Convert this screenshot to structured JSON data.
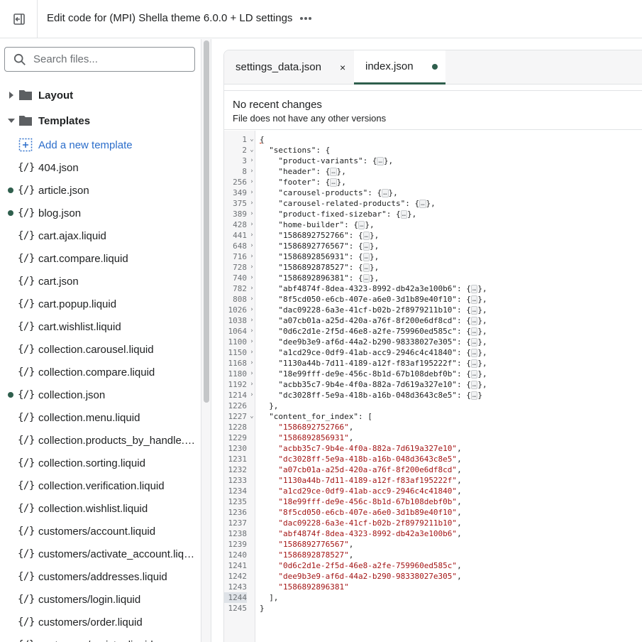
{
  "topbar": {
    "title": "Edit code for (MPI) Shella theme 6.0.0 + LD settings",
    "exit_icon": "exit-icon",
    "more_icon": "more-horizontal-icon"
  },
  "search": {
    "placeholder": "Search files..."
  },
  "tree": {
    "layout_label": "Layout",
    "templates_label": "Templates",
    "add_template_label": "Add a new template",
    "file_icon_glyph": "{/}",
    "files": [
      {
        "name": "404.json",
        "modified": false
      },
      {
        "name": "article.json",
        "modified": true
      },
      {
        "name": "blog.json",
        "modified": true
      },
      {
        "name": "cart.ajax.liquid",
        "modified": false
      },
      {
        "name": "cart.compare.liquid",
        "modified": false
      },
      {
        "name": "cart.json",
        "modified": false
      },
      {
        "name": "cart.popup.liquid",
        "modified": false
      },
      {
        "name": "cart.wishlist.liquid",
        "modified": false
      },
      {
        "name": "collection.carousel.liquid",
        "modified": false
      },
      {
        "name": "collection.compare.liquid",
        "modified": false
      },
      {
        "name": "collection.json",
        "modified": true
      },
      {
        "name": "collection.menu.liquid",
        "modified": false
      },
      {
        "name": "collection.products_by_handle.liquid",
        "modified": false
      },
      {
        "name": "collection.sorting.liquid",
        "modified": false
      },
      {
        "name": "collection.verification.liquid",
        "modified": false
      },
      {
        "name": "collection.wishlist.liquid",
        "modified": false
      },
      {
        "name": "customers/account.liquid",
        "modified": false
      },
      {
        "name": "customers/activate_account.liquid",
        "modified": false
      },
      {
        "name": "customers/addresses.liquid",
        "modified": false
      },
      {
        "name": "customers/login.liquid",
        "modified": false
      },
      {
        "name": "customers/order.liquid",
        "modified": false
      },
      {
        "name": "customers/register.liquid",
        "modified": false
      }
    ]
  },
  "tabs": [
    {
      "label": "settings_data.json",
      "close": "×"
    },
    {
      "label": "index.json"
    }
  ],
  "notice": {
    "title": "No recent changes",
    "subtitle": "File does not have any other versions"
  },
  "colors": {
    "accent": "#2f5f4d",
    "link": "#2c6ecb",
    "string": "#a31515"
  },
  "code": {
    "ellipsis": "…",
    "active_line": "1244",
    "lines": [
      {
        "n": "1",
        "f": "⌄",
        "indent": 0,
        "text": "{",
        "kind": "plain"
      },
      {
        "n": "2",
        "f": "⌄",
        "indent": 2,
        "text": "\"sections\": {",
        "kind": "plain"
      },
      {
        "n": "3",
        "f": "›",
        "indent": 4,
        "key": "\"product-variants\": ",
        "tail": "},",
        "kind": "fold"
      },
      {
        "n": "8",
        "f": "›",
        "indent": 4,
        "key": "\"header\": ",
        "tail": "},",
        "kind": "fold"
      },
      {
        "n": "256",
        "f": "›",
        "indent": 4,
        "key": "\"footer\": ",
        "tail": "},",
        "kind": "fold"
      },
      {
        "n": "349",
        "f": "›",
        "indent": 4,
        "key": "\"carousel-products\": ",
        "tail": "},",
        "kind": "fold"
      },
      {
        "n": "375",
        "f": "›",
        "indent": 4,
        "key": "\"carousel-related-products\": ",
        "tail": "},",
        "kind": "fold"
      },
      {
        "n": "389",
        "f": "›",
        "indent": 4,
        "key": "\"product-fixed-sizebar\": ",
        "tail": "},",
        "kind": "fold"
      },
      {
        "n": "428",
        "f": "›",
        "indent": 4,
        "key": "\"home-builder\": ",
        "tail": "},",
        "kind": "fold"
      },
      {
        "n": "441",
        "f": "›",
        "indent": 4,
        "key": "\"1586892752766\": ",
        "tail": "},",
        "kind": "fold"
      },
      {
        "n": "648",
        "f": "›",
        "indent": 4,
        "key": "\"1586892776567\": ",
        "tail": "},",
        "kind": "fold"
      },
      {
        "n": "716",
        "f": "›",
        "indent": 4,
        "key": "\"1586892856931\": ",
        "tail": "},",
        "kind": "fold"
      },
      {
        "n": "728",
        "f": "›",
        "indent": 4,
        "key": "\"1586892878527\": ",
        "tail": "},",
        "kind": "fold"
      },
      {
        "n": "740",
        "f": "›",
        "indent": 4,
        "key": "\"1586892896381\": ",
        "tail": "},",
        "kind": "fold"
      },
      {
        "n": "782",
        "f": "›",
        "indent": 4,
        "key": "\"abf4874f-8dea-4323-8992-db42a3e100b6\": ",
        "tail": "},",
        "kind": "fold"
      },
      {
        "n": "808",
        "f": "›",
        "indent": 4,
        "key": "\"8f5cd050-e6cb-407e-a6e0-3d1b89e40f10\": ",
        "tail": "},",
        "kind": "fold"
      },
      {
        "n": "1026",
        "f": "›",
        "indent": 4,
        "key": "\"dac09228-6a3e-41cf-b02b-2f8979211b10\": ",
        "tail": "},",
        "kind": "fold"
      },
      {
        "n": "1038",
        "f": "›",
        "indent": 4,
        "key": "\"a07cb01a-a25d-420a-a76f-8f200e6df8cd\": ",
        "tail": "},",
        "kind": "fold"
      },
      {
        "n": "1064",
        "f": "›",
        "indent": 4,
        "key": "\"0d6c2d1e-2f5d-46e8-a2fe-759960ed585c\": ",
        "tail": "},",
        "kind": "fold"
      },
      {
        "n": "1100",
        "f": "›",
        "indent": 4,
        "key": "\"dee9b3e9-af6d-44a2-b290-98338027e305\": ",
        "tail": "},",
        "kind": "fold"
      },
      {
        "n": "1150",
        "f": "›",
        "indent": 4,
        "key": "\"a1cd29ce-0df9-41ab-acc9-2946c4c41840\": ",
        "tail": "},",
        "kind": "fold"
      },
      {
        "n": "1168",
        "f": "›",
        "indent": 4,
        "key": "\"1130a44b-7d11-4189-a12f-f83af195222f\": ",
        "tail": "},",
        "kind": "fold"
      },
      {
        "n": "1180",
        "f": "›",
        "indent": 4,
        "key": "\"18e99fff-de9e-456c-8b1d-67b108debf0b\": ",
        "tail": "},",
        "kind": "fold"
      },
      {
        "n": "1192",
        "f": "›",
        "indent": 4,
        "key": "\"acbb35c7-9b4e-4f0a-882a-7d619a327e10\": ",
        "tail": "},",
        "kind": "fold"
      },
      {
        "n": "1214",
        "f": "›",
        "indent": 4,
        "key": "\"dc3028ff-5e9a-418b-a16b-048d3643c8e5\": ",
        "tail": "}",
        "kind": "fold"
      },
      {
        "n": "1226",
        "f": "",
        "indent": 2,
        "text": "},",
        "kind": "plain"
      },
      {
        "n": "1227",
        "f": "⌄",
        "indent": 2,
        "text": "\"content_for_index\": [",
        "kind": "plain"
      },
      {
        "n": "1228",
        "f": "",
        "indent": 4,
        "str": "\"1586892752766\"",
        "tail": ",",
        "kind": "str"
      },
      {
        "n": "1229",
        "f": "",
        "indent": 4,
        "str": "\"1586892856931\"",
        "tail": ",",
        "kind": "str"
      },
      {
        "n": "1230",
        "f": "",
        "indent": 4,
        "str": "\"acbb35c7-9b4e-4f0a-882a-7d619a327e10\"",
        "tail": ",",
        "kind": "str"
      },
      {
        "n": "1231",
        "f": "",
        "indent": 4,
        "str": "\"dc3028ff-5e9a-418b-a16b-048d3643c8e5\"",
        "tail": ",",
        "kind": "str"
      },
      {
        "n": "1232",
        "f": "",
        "indent": 4,
        "str": "\"a07cb01a-a25d-420a-a76f-8f200e6df8cd\"",
        "tail": ",",
        "kind": "str"
      },
      {
        "n": "1233",
        "f": "",
        "indent": 4,
        "str": "\"1130a44b-7d11-4189-a12f-f83af195222f\"",
        "tail": ",",
        "kind": "str"
      },
      {
        "n": "1234",
        "f": "",
        "indent": 4,
        "str": "\"a1cd29ce-0df9-41ab-acc9-2946c4c41840\"",
        "tail": ",",
        "kind": "str"
      },
      {
        "n": "1235",
        "f": "",
        "indent": 4,
        "str": "\"18e99fff-de9e-456c-8b1d-67b108debf0b\"",
        "tail": ",",
        "kind": "str"
      },
      {
        "n": "1236",
        "f": "",
        "indent": 4,
        "str": "\"8f5cd050-e6cb-407e-a6e0-3d1b89e40f10\"",
        "tail": ",",
        "kind": "str"
      },
      {
        "n": "1237",
        "f": "",
        "indent": 4,
        "str": "\"dac09228-6a3e-41cf-b02b-2f8979211b10\"",
        "tail": ",",
        "kind": "str"
      },
      {
        "n": "1238",
        "f": "",
        "indent": 4,
        "str": "\"abf4874f-8dea-4323-8992-db42a3e100b6\"",
        "tail": ",",
        "kind": "str"
      },
      {
        "n": "1239",
        "f": "",
        "indent": 4,
        "str": "\"1586892776567\"",
        "tail": ",",
        "kind": "str"
      },
      {
        "n": "1240",
        "f": "",
        "indent": 4,
        "str": "\"1586892878527\"",
        "tail": ",",
        "kind": "str"
      },
      {
        "n": "1241",
        "f": "",
        "indent": 4,
        "str": "\"0d6c2d1e-2f5d-46e8-a2fe-759960ed585c\"",
        "tail": ",",
        "kind": "str"
      },
      {
        "n": "1242",
        "f": "",
        "indent": 4,
        "str": "\"dee9b3e9-af6d-44a2-b290-98338027e305\"",
        "tail": ",",
        "kind": "str"
      },
      {
        "n": "1243",
        "f": "",
        "indent": 4,
        "str": "\"1586892896381\"",
        "tail": "",
        "kind": "str"
      },
      {
        "n": "1244",
        "f": "",
        "indent": 2,
        "text": "],",
        "kind": "plain"
      },
      {
        "n": "1245",
        "f": "",
        "indent": 0,
        "text": "}",
        "kind": "plain"
      }
    ]
  }
}
